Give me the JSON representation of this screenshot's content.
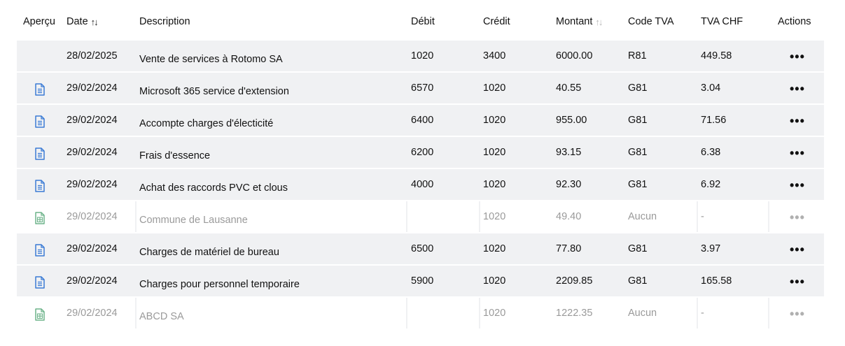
{
  "colors": {
    "row_bg": "#f0f1f3",
    "doc_icon": "#3a7bd5",
    "sheet_icon": "#6db38a",
    "muted_text": "#9a9a9a"
  },
  "headers": {
    "apercu": "Aperçu",
    "date": "Date",
    "description": "Description",
    "debit": "Débit",
    "credit": "Crédit",
    "montant": "Montant",
    "code_tva": "Code TVA",
    "tva_chf": "TVA CHF",
    "actions": "Actions"
  },
  "rows": [
    {
      "icon": "none",
      "muted": false,
      "date": "28/02/2025",
      "description": "Vente de services à Rotomo SA",
      "debit": "1020",
      "credit": "3400",
      "montant": "6000.00",
      "code_tva": "R81",
      "tva_chf": "449.58",
      "actions": "•••"
    },
    {
      "icon": "document-icon",
      "muted": false,
      "date": "29/02/2024",
      "description": "Microsoft 365 service d'extension",
      "debit": "6570",
      "credit": "1020",
      "montant": "40.55",
      "code_tva": "G81",
      "tva_chf": "3.04",
      "actions": "•••"
    },
    {
      "icon": "document-icon",
      "muted": false,
      "date": "29/02/2024",
      "description": "Accompte charges d'électicité",
      "debit": "6400",
      "credit": "1020",
      "montant": "955.00",
      "code_tva": "G81",
      "tva_chf": "71.56",
      "actions": "•••"
    },
    {
      "icon": "document-icon",
      "muted": false,
      "date": "29/02/2024",
      "description": "Frais d'essence",
      "debit": "6200",
      "credit": "1020",
      "montant": "93.15",
      "code_tva": "G81",
      "tva_chf": "6.38",
      "actions": "•••"
    },
    {
      "icon": "document-icon",
      "muted": false,
      "date": "29/02/2024",
      "description": "Achat des raccords PVC et clous",
      "debit": "4000",
      "credit": "1020",
      "montant": "92.30",
      "code_tva": "G81",
      "tva_chf": "6.92",
      "actions": "•••"
    },
    {
      "icon": "spreadsheet-icon",
      "muted": true,
      "date": "29/02/2024",
      "description": "Commune de Lausanne",
      "debit": "",
      "credit": "1020",
      "montant": "49.40",
      "code_tva": "Aucun",
      "tva_chf": "-",
      "actions": "•••"
    },
    {
      "icon": "document-icon",
      "muted": false,
      "date": "29/02/2024",
      "description": "Charges de matériel de bureau",
      "debit": "6500",
      "credit": "1020",
      "montant": "77.80",
      "code_tva": "G81",
      "tva_chf": "3.97",
      "actions": "•••"
    },
    {
      "icon": "document-icon",
      "muted": false,
      "date": "29/02/2024",
      "description": "Charges pour personnel temporaire",
      "debit": "5900",
      "credit": "1020",
      "montant": "2209.85",
      "code_tva": "G81",
      "tva_chf": "165.58",
      "actions": "•••"
    },
    {
      "icon": "spreadsheet-icon",
      "muted": true,
      "date": "29/02/2024",
      "description": "ABCD SA",
      "debit": "",
      "credit": "1020",
      "montant": "1222.35",
      "code_tva": "Aucun",
      "tva_chf": "-",
      "actions": "•••"
    }
  ]
}
